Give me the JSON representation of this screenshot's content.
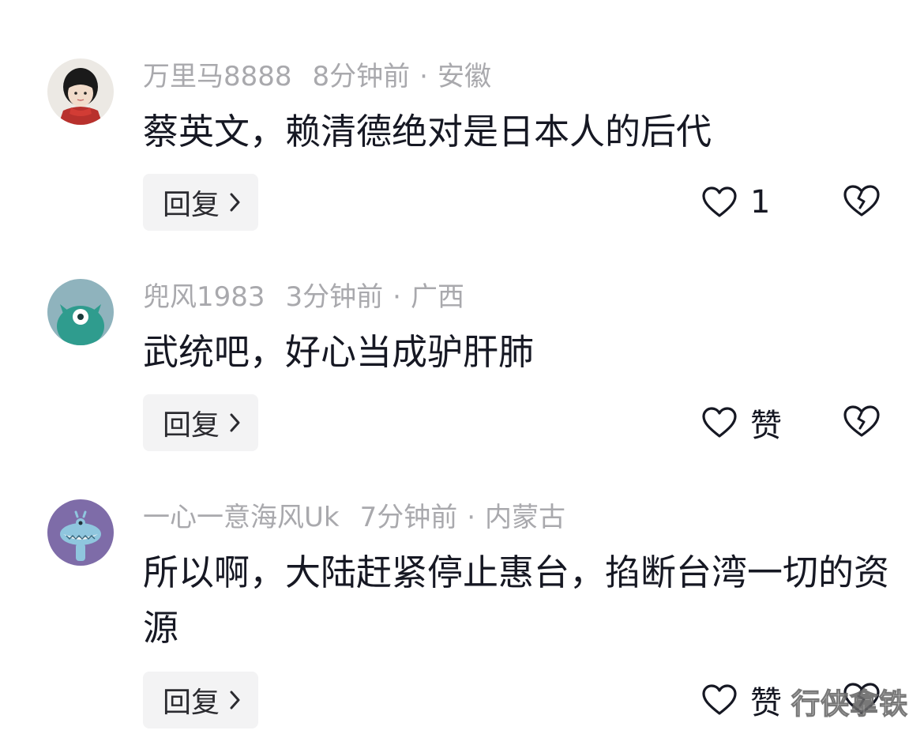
{
  "comments": [
    {
      "username": "万里马8888",
      "time": "8分钟前",
      "separator": "·",
      "location": "安徽",
      "text": "蔡英文，赖清德绝对是日本人的后代",
      "reply_label": "回复",
      "like_label": "1",
      "avatar_icon": "boy-with-red-scarf-avatar"
    },
    {
      "username": "兜风1983",
      "time": "3分钟前",
      "separator": "·",
      "location": "广西",
      "text": "武统吧，好心当成驴肝肺",
      "reply_label": "回复",
      "like_label": "赞",
      "avatar_icon": "teal-one-eyed-monster-avatar"
    },
    {
      "username": "一心一意海风Uk",
      "time": "7分钟前",
      "separator": "·",
      "location": "内蒙古",
      "text": "所以啊，大陆赶紧停止惠台，掐断台湾一切的资源",
      "reply_label": "回复",
      "like_label": "赞",
      "avatar_icon": "blue-fish-monster-avatar"
    }
  ],
  "watermark": "行侠拿铁",
  "colors": {
    "meta_gray": "#a9a9ad",
    "text_dark": "#161823",
    "reply_bg": "#f3f3f4"
  }
}
